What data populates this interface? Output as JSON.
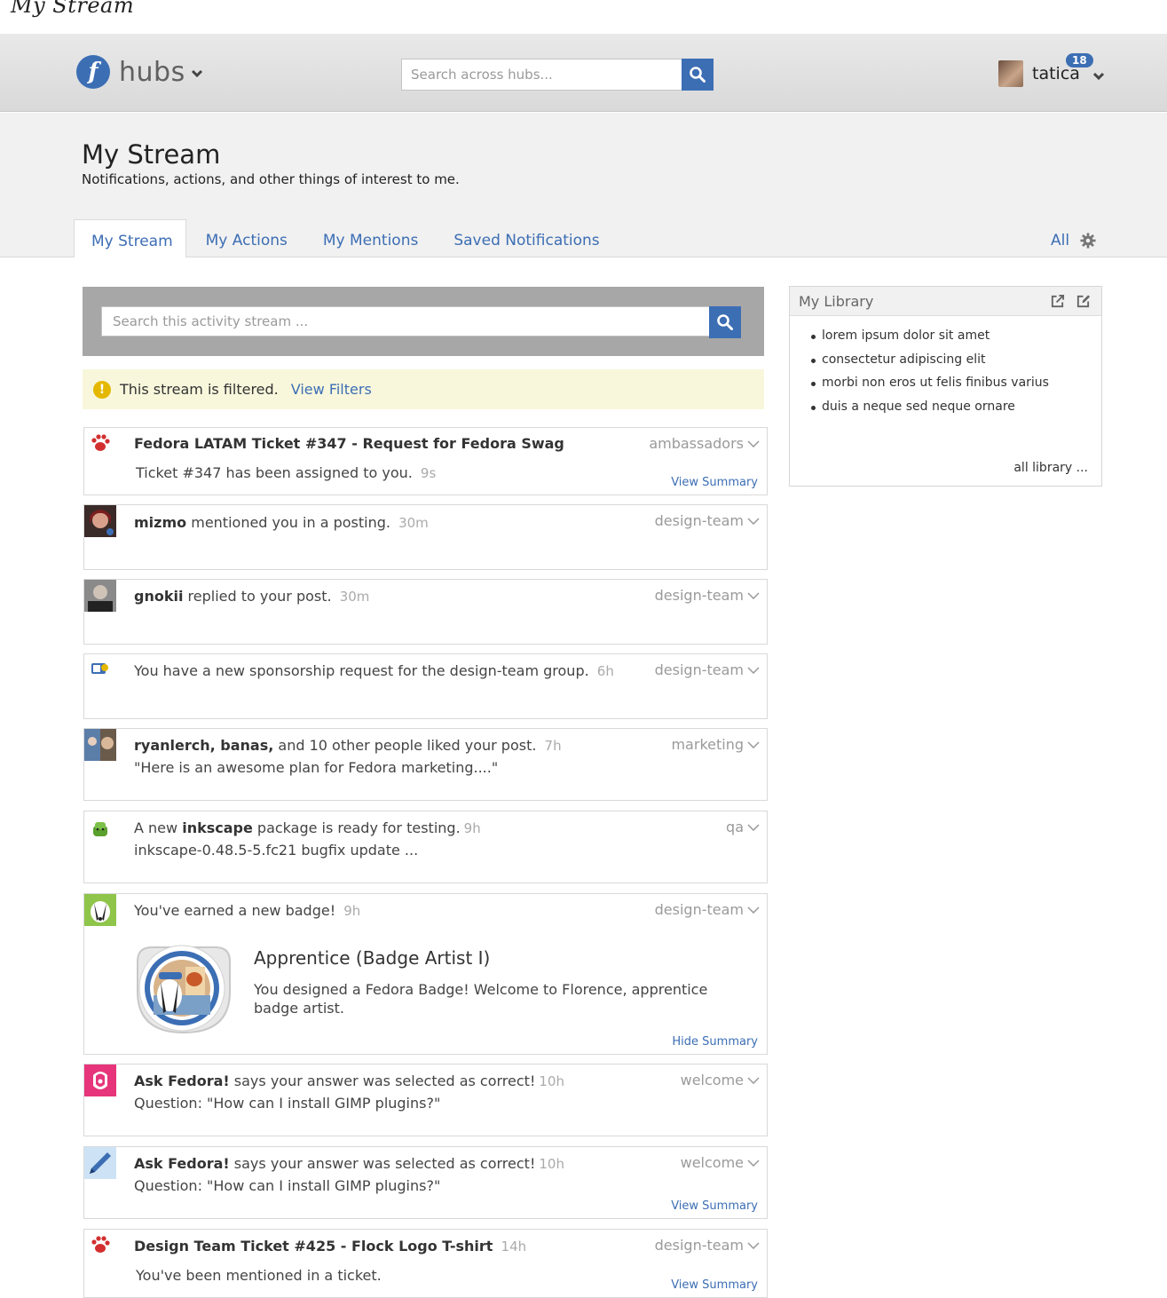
{
  "sketch_title": "My Stream",
  "brand": {
    "name": "hubs"
  },
  "global_search": {
    "placeholder": "Search across hubs..."
  },
  "user": {
    "name": "tatica",
    "notifications": "18"
  },
  "page": {
    "title": "My Stream",
    "subtitle": "Notifications, actions, and other things of interest to me."
  },
  "tabs": [
    {
      "label": "My Stream",
      "active": true
    },
    {
      "label": "My Actions"
    },
    {
      "label": "My Mentions"
    },
    {
      "label": "Saved Notifications"
    }
  ],
  "filter_all": "All",
  "stream_search": {
    "placeholder": "Search this activity stream ..."
  },
  "filter_notice": {
    "message": "This stream is filtered.",
    "link": "View Filters"
  },
  "stream": [
    {
      "title": "Fedora LATAM Ticket #347 - Request for Fedora Swag",
      "body": "Ticket #347 has been assigned to you.",
      "time": "9s",
      "group": "ambassadors",
      "action": "View Summary"
    },
    {
      "actor": "mizmo",
      "text": "mentioned you in a posting.",
      "time": "30m",
      "group": "design-team"
    },
    {
      "actor": "gnokii",
      "text": "replied to your post.",
      "time": "30m",
      "group": "design-team"
    },
    {
      "text": "You have a new sponsorship request for the design-team group.",
      "time": "6h",
      "group": "design-team"
    },
    {
      "actor": "ryanlerch, banas,",
      "text": "and 10 other people liked your post.",
      "time": "7h",
      "quote": "\"Here is an awesome plan for Fedora marketing....\"",
      "group": "marketing"
    },
    {
      "pre": "A new",
      "actor": "inkscape",
      "text": "package is ready for testing.",
      "time": "9h",
      "detail": "inkscape-0.48.5-5.fc21 bugfix update ...",
      "group": "qa"
    },
    {
      "text": "You've earned a new badge!",
      "time": "9h",
      "group": "design-team",
      "badge_title": "Apprentice (Badge Artist I)",
      "badge_desc": "You designed a Fedora Badge! Welcome to Florence, apprentice badge artist.",
      "action": "Hide Summary"
    },
    {
      "actor": "Ask Fedora!",
      "text": "says your answer was selected as correct!",
      "time": "10h",
      "question": "Question: \"How can I install GIMP plugins?\"",
      "group": "welcome"
    },
    {
      "actor": "Ask Fedora!",
      "text": "says your answer was selected as correct!",
      "time": "10h",
      "question": "Question: \"How can I install GIMP plugins?\"",
      "group": "welcome",
      "action": "View Summary"
    },
    {
      "title": "Design Team Ticket #425 - Flock Logo T-shirt",
      "time": "14h",
      "body": "You've been mentioned in a ticket.",
      "group": "design-team",
      "action": "View Summary"
    }
  ],
  "library": {
    "title": "My Library",
    "items": [
      "lorem ipsum dolor sit amet",
      "consectetur adipiscing elit",
      "morbi non eros ut felis finibus varius",
      "duis a neque sed neque ornare"
    ],
    "more": "all library ..."
  },
  "colors": {
    "accent": "#3c6eb4",
    "header_bg": "#dedede",
    "notice_bg": "#f8f7dc",
    "group_text": "#9a9a9a"
  }
}
